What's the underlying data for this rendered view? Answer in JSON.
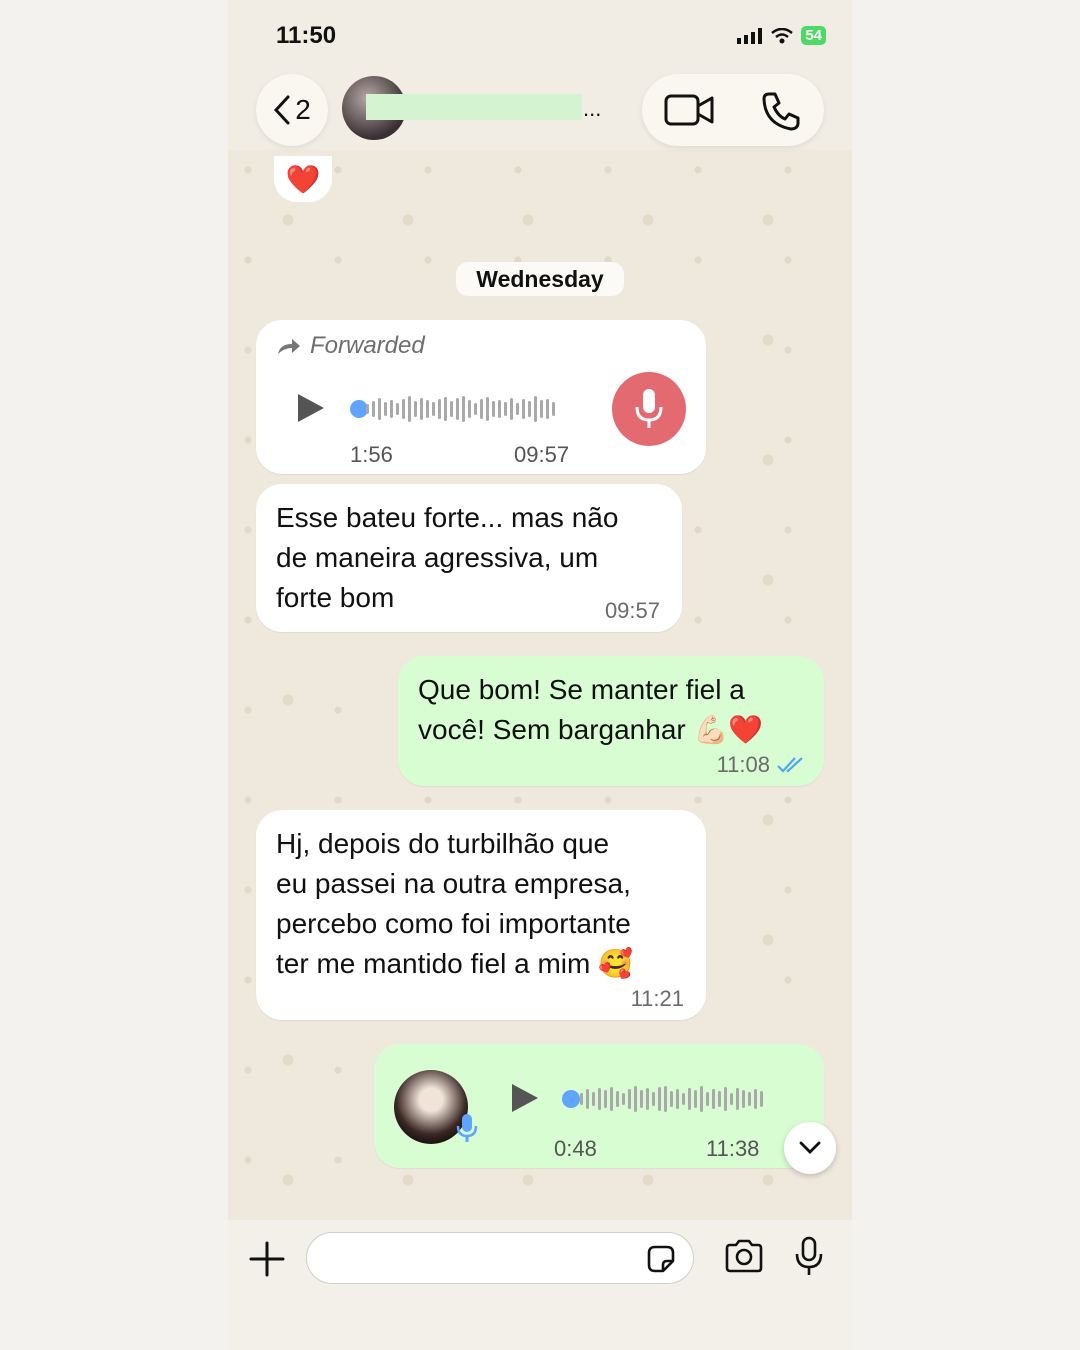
{
  "status_bar": {
    "time": "11:50",
    "battery": "54"
  },
  "header": {
    "back_count": "2",
    "name_ellipsis": "...",
    "video_icon": "video-camera-icon",
    "call_icon": "phone-icon"
  },
  "reaction": {
    "emoji": "❤️"
  },
  "date_chip": "Wednesday",
  "messages": [
    {
      "type": "voice",
      "direction": "incoming",
      "forwarded_label": "Forwarded",
      "duration": "1:56",
      "time": "09:57"
    },
    {
      "type": "text",
      "direction": "incoming",
      "lines": [
        "Esse bateu forte... mas não",
        "de maneira agressiva, um",
        "forte bom"
      ],
      "time": "09:57"
    },
    {
      "type": "text",
      "direction": "outgoing",
      "lines": [
        "Que bom! Se manter fiel a",
        "você! Sem barganhar 💪🏻❤️"
      ],
      "time": "11:08"
    },
    {
      "type": "text",
      "direction": "incoming",
      "lines": [
        "Hj, depois do turbilhão que",
        "eu passei na outra empresa,",
        "percebo como foi importante",
        "ter me mantido fiel a mim 🥰"
      ],
      "time": "11:21"
    },
    {
      "type": "voice",
      "direction": "outgoing",
      "duration": "0:48",
      "time": "11:38"
    }
  ],
  "input": {
    "placeholder": ""
  },
  "colors": {
    "incoming_bubble": "#ffffff",
    "outgoing_bubble": "#d9fdd3",
    "read_ticks": "#4fa6f5",
    "record_mic": "#e36a70"
  }
}
